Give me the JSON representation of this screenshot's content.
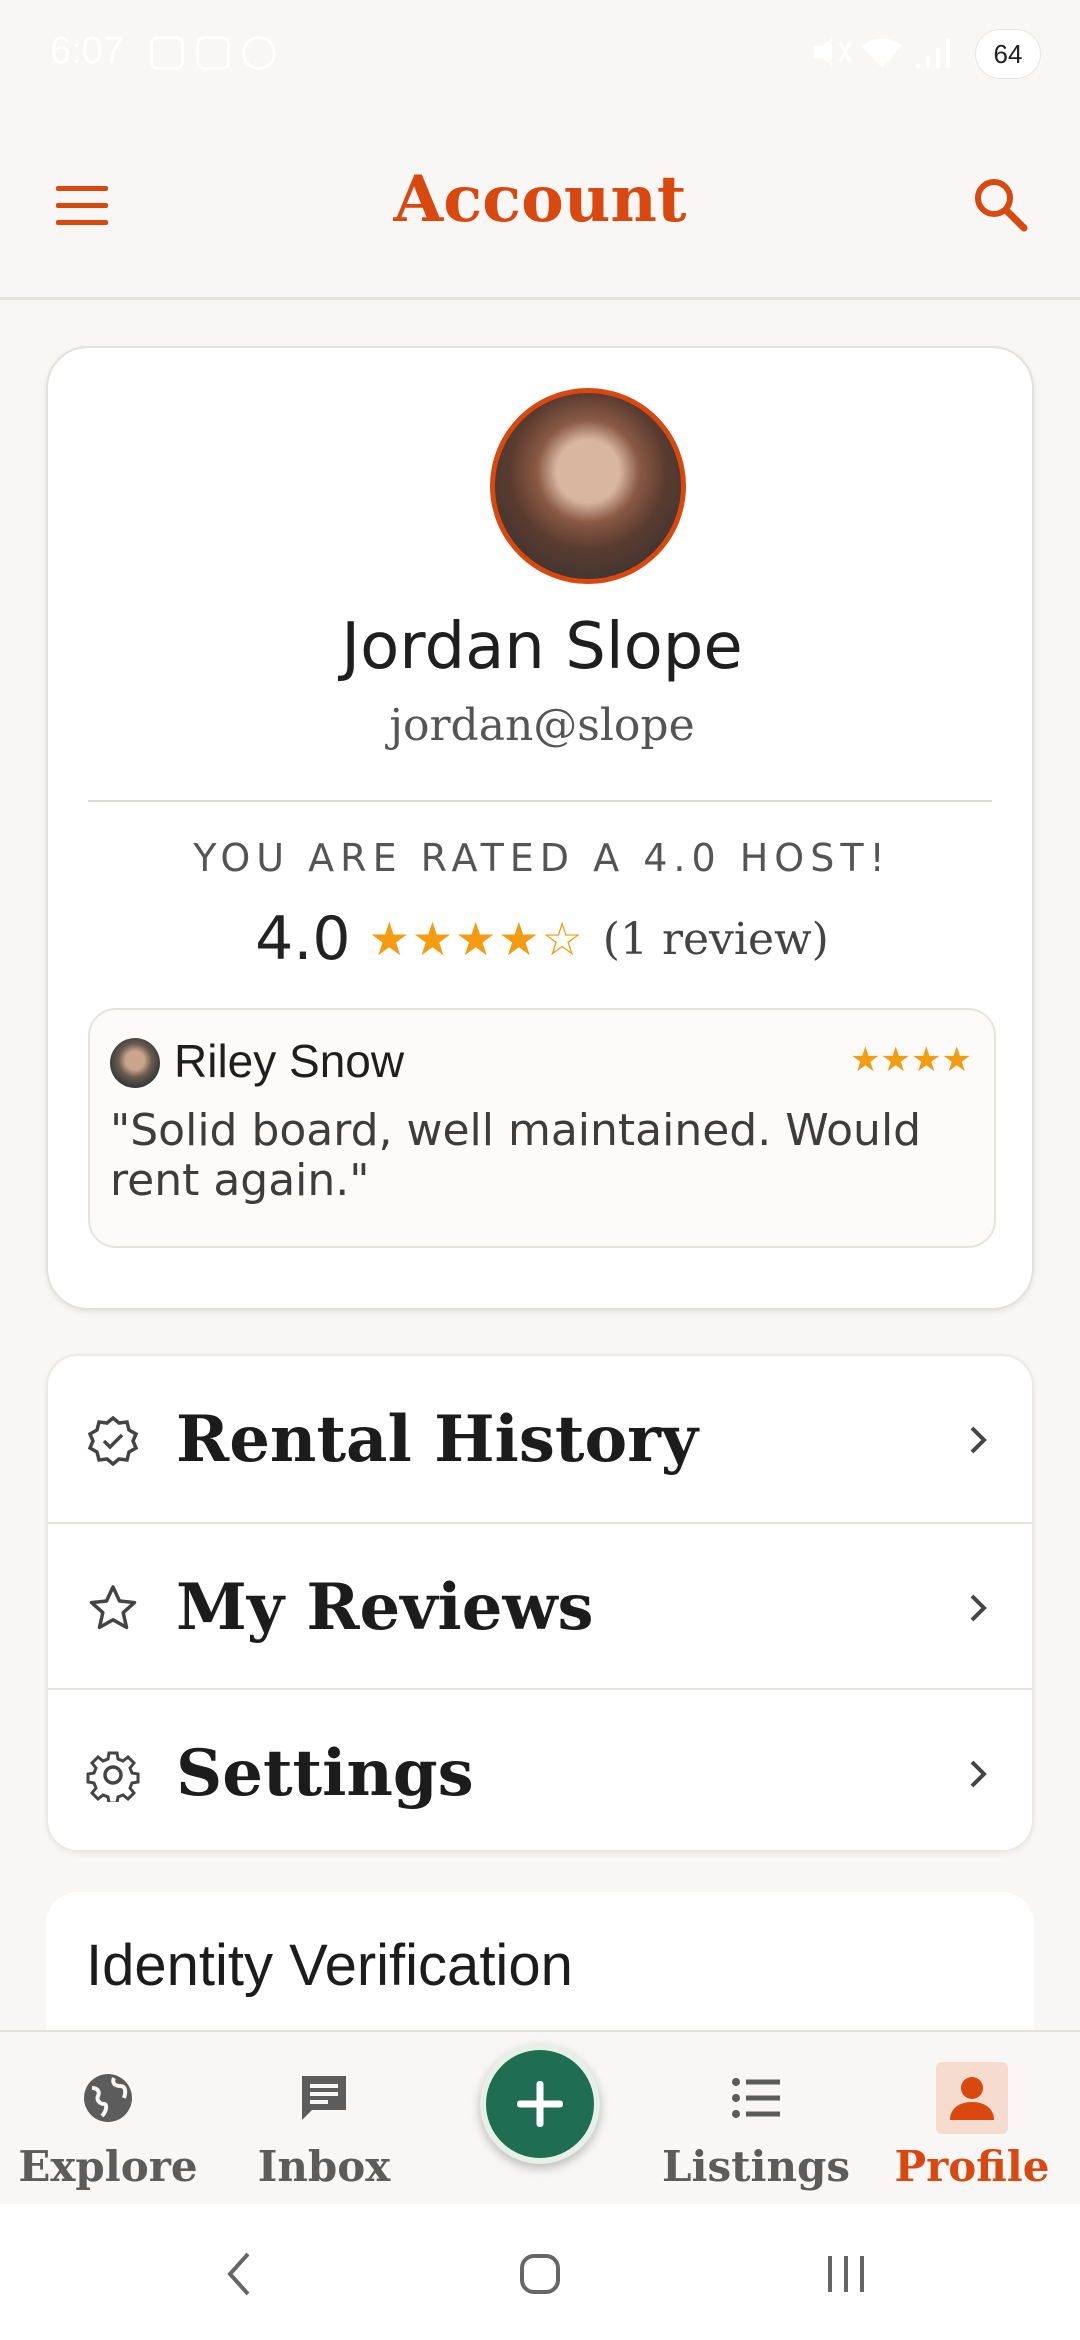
{
  "status_bar": {
    "time": "6:07",
    "battery": "64"
  },
  "appbar": {
    "title": "Account",
    "menu_icon": "menu-icon",
    "search_icon": "search-icon"
  },
  "profile": {
    "name": "Jordan Slope",
    "handle": "jordan@slope",
    "rated_text": "YOU ARE RATED A 4.0 HOST!",
    "rating": "4.0",
    "stars": "★★★★☆",
    "review_count": "(1 review)"
  },
  "review": {
    "reviewer": "Riley Snow",
    "stars": "★★★★",
    "text": "\"Solid board, well maintained. Would rent again.\""
  },
  "menu": [
    {
      "label": "Rental History",
      "icon": "verified-badge-icon"
    },
    {
      "label": "My Reviews",
      "icon": "star-outline-icon"
    },
    {
      "label": "Settings",
      "icon": "gear-icon"
    }
  ],
  "identity": {
    "label": "Identity Verification"
  },
  "bottom_nav": [
    {
      "label": "Explore",
      "icon": "globe-icon"
    },
    {
      "label": "Inbox",
      "icon": "chat-icon"
    },
    {
      "label": "Listings",
      "icon": "list-icon"
    },
    {
      "label": "Profile",
      "icon": "person-icon",
      "active": true
    }
  ],
  "colors": {
    "accent": "#d9480f",
    "star": "#f39c12",
    "fab": "#1f6e54"
  }
}
